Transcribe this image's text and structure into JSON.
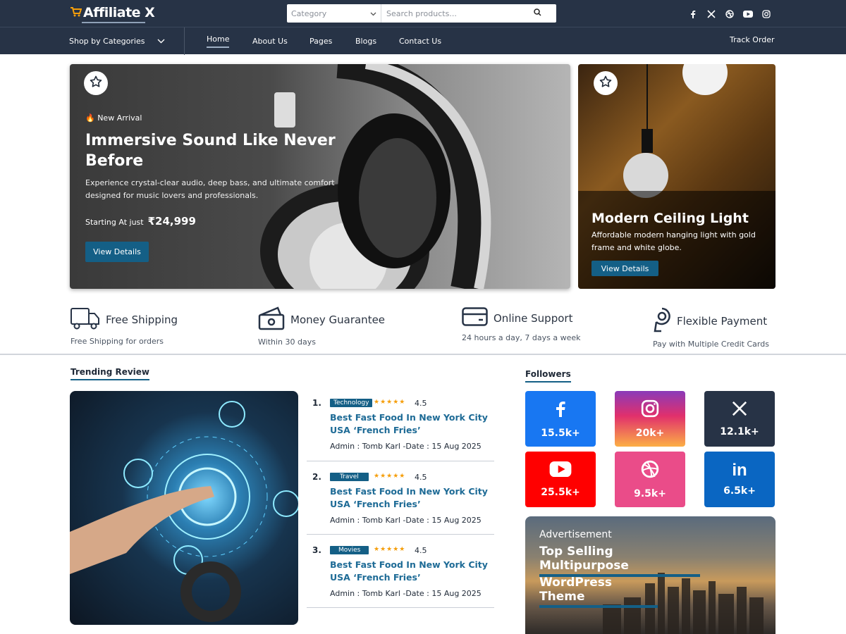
{
  "header": {
    "logo_text": "Affiliate X",
    "search": {
      "category_placeholder": "Category",
      "placeholder": "Search products..."
    },
    "social_icons": [
      "facebook-icon",
      "x-icon",
      "dribbble-icon",
      "youtube-icon",
      "instagram-icon"
    ]
  },
  "nav": {
    "shop_by_categories": "Shop by Categories",
    "items": [
      "Home",
      "About Us",
      "Pages",
      "Blogs",
      "Contact Us"
    ],
    "active": "Home",
    "track_order": "Track Order"
  },
  "hero": {
    "tag": "New Arrival",
    "title": "Immersive Sound Like Never Before",
    "description": "Experience crystal-clear audio, deep bass, and ultimate comfort designed for music lovers and professionals.",
    "price_label": "Starting At just",
    "price": "₹24,999",
    "button": "View Details"
  },
  "side_banner": {
    "title": "Modern Ceiling Light",
    "description": "Affordable modern hanging light with gold frame and white globe.",
    "button": "View Details"
  },
  "features": [
    {
      "title": "Free Shipping",
      "sub": "Free Shipping for orders"
    },
    {
      "title": "Money Guarantee",
      "sub": "Within 30 days"
    },
    {
      "title": "Online Support",
      "sub": "24 hours a day, 7 days a week"
    },
    {
      "title": "Flexible Payment",
      "sub": "Pay with Multiple Credit Cards"
    }
  ],
  "trending": {
    "heading": "Trending Review",
    "reviews": [
      {
        "num": "1.",
        "category": "Technology",
        "stars": "★★★★★",
        "rating": "4.5",
        "title": "Best Fast Food In New York City USA ‘French Fries’",
        "meta": "Admin : Tomb Karl -Date : 15 Aug 2025"
      },
      {
        "num": "2.",
        "category": "Travel",
        "stars": "★★★★★",
        "rating": "4.5",
        "title": "Best Fast Food In New York City USA ‘French Fries’",
        "meta": "Admin : Tomb Karl -Date : 15 Aug 2025"
      },
      {
        "num": "3.",
        "category": "Movies",
        "stars": "★★★★★",
        "rating": "4.5",
        "title": "Best Fast Food In New York City USA ‘French Fries’",
        "meta": "Admin : Tomb Karl -Date : 15 Aug 2025"
      }
    ]
  },
  "followers": {
    "heading": "Followers",
    "items": [
      {
        "network": "facebook",
        "count": "15.5k+",
        "color": "#1877f2"
      },
      {
        "network": "instagram",
        "count": "20k+",
        "color": "#d62976"
      },
      {
        "network": "x",
        "count": "12.1k+",
        "color": "#273346"
      },
      {
        "network": "youtube",
        "count": "25.5k+",
        "color": "#ff0000"
      },
      {
        "network": "dribbble",
        "count": "9.5k+",
        "color": "#ea4c89"
      },
      {
        "network": "linkedin",
        "count": "6.5k+",
        "color": "#0a66c2"
      }
    ]
  },
  "advertisement": {
    "label": "Advertisement",
    "line1": "Top Selling Multipurpose",
    "line2": "WordPress Theme"
  },
  "colors": {
    "nav_bg": "#273346",
    "accent": "#145f86",
    "link": "#1e6b96"
  }
}
